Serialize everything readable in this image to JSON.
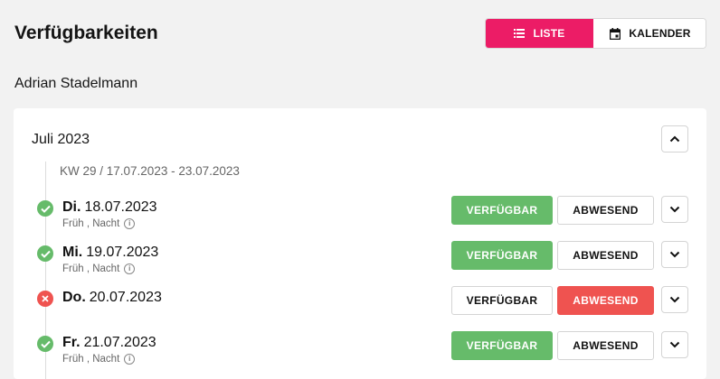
{
  "header": {
    "title": "Verfügbarkeiten",
    "view_toggle": {
      "list_label": "LISTE",
      "list_icon": "list-icon",
      "calendar_label": "KALENDER",
      "calendar_icon": "calendar-icon",
      "active": "list"
    }
  },
  "person": {
    "name": "Adrian Stadelmann"
  },
  "month": {
    "title": "Juli 2023",
    "collapse_icon": "chevron-up-icon",
    "week_label": "KW 29 / 17.07.2023 - 23.07.2023",
    "days": [
      {
        "dow": "Di.",
        "date": "18.07.2023",
        "status": "available",
        "status_icon": "check-circle-icon",
        "shifts": "Früh , Nacht",
        "available_label": "VERFÜGBAR",
        "absent_label": "ABWESEND"
      },
      {
        "dow": "Mi.",
        "date": "19.07.2023",
        "status": "available",
        "status_icon": "check-circle-icon",
        "shifts": "Früh , Nacht",
        "available_label": "VERFÜGBAR",
        "absent_label": "ABWESEND"
      },
      {
        "dow": "Do.",
        "date": "20.07.2023",
        "status": "absent",
        "status_icon": "x-circle-icon",
        "shifts": "",
        "available_label": "VERFÜGBAR",
        "absent_label": "ABWESEND"
      },
      {
        "dow": "Fr.",
        "date": "21.07.2023",
        "status": "available",
        "status_icon": "check-circle-icon",
        "shifts": "Früh , Nacht",
        "available_label": "VERFÜGBAR",
        "absent_label": "ABWESEND"
      }
    ]
  },
  "colors": {
    "accent": "#ec1c66",
    "available": "#66bb6a",
    "absent": "#ef5350",
    "background": "#f2f2f2"
  }
}
